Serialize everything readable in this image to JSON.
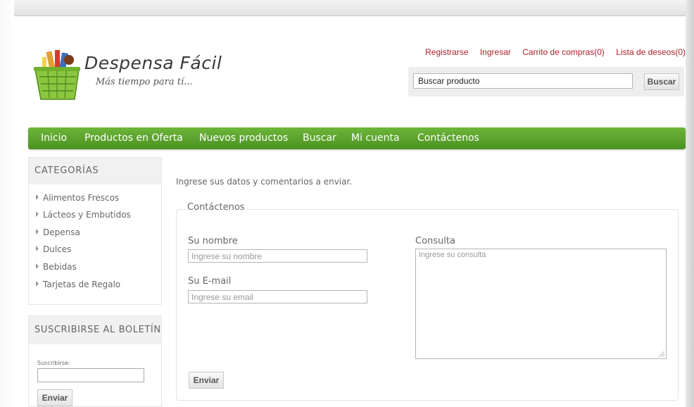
{
  "brand": {
    "name": "Despensa Fácil",
    "tagline": "Más tiempo para tí..."
  },
  "top_links": [
    "Registrarse",
    "Ingresar",
    "Carrito de compras(0)",
    "Lista de deseos(0)"
  ],
  "search": {
    "value": "Buscar producto",
    "button": "Buscar"
  },
  "nav": [
    "Inicio",
    "Productos en Oferta",
    "Nuevos productos",
    "Buscar",
    "Mi cuenta",
    "Contáctenos"
  ],
  "categories": {
    "title": "CATEGORÍAS",
    "items": [
      "Alimentos Frescos",
      "Lácteos y Embutidos",
      "Depensa",
      "Dulces",
      "Bebidas",
      "Tarjetas de Regalo"
    ]
  },
  "newsletter": {
    "title": "SUSCRIBIRSE AL BOLETÍN",
    "label": "Suscribirse:",
    "button": "Enviar"
  },
  "contact": {
    "intro": "Ingrese sus datos y comentarios a enviar.",
    "legend": "Contáctenos",
    "name_label": "Su nombre",
    "name_placeholder": "Ingrese su nombre",
    "email_label": "Su E-mail",
    "email_placeholder": "Ingrese su email",
    "query_label": "Consulta",
    "query_placeholder": "Ingrese su consulta",
    "submit": "Enviar"
  },
  "colors": {
    "nav_green": "#5fa32f",
    "link_red": "#b01f2b"
  }
}
